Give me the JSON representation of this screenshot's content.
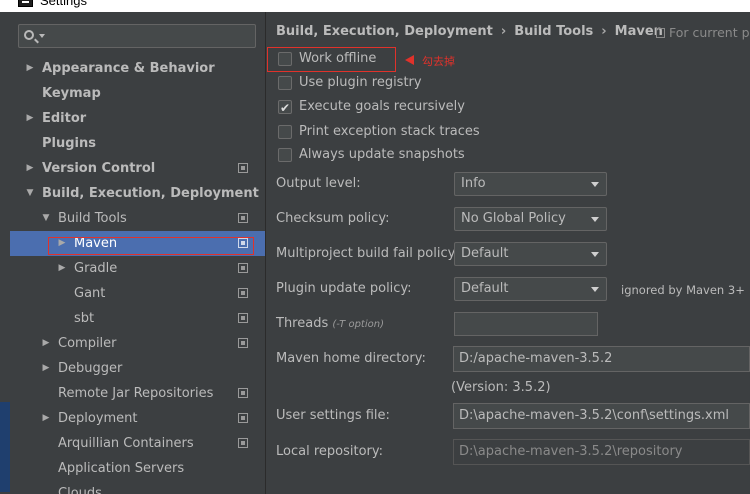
{
  "window": {
    "title": "Settings"
  },
  "search": {
    "placeholder": ""
  },
  "tree": [
    {
      "label": "Appearance & Behavior",
      "bold": true,
      "arrow": "▶",
      "level": 0,
      "icon": false
    },
    {
      "label": "Keymap",
      "bold": true,
      "arrow": "",
      "level": 0,
      "icon": false
    },
    {
      "label": "Editor",
      "bold": true,
      "arrow": "▶",
      "level": 0,
      "icon": false
    },
    {
      "label": "Plugins",
      "bold": true,
      "arrow": "",
      "level": 0,
      "icon": false
    },
    {
      "label": "Version Control",
      "bold": true,
      "arrow": "▶",
      "level": 0,
      "icon": true
    },
    {
      "label": "Build, Execution, Deployment",
      "bold": true,
      "arrow": "▼",
      "level": 0,
      "icon": false
    },
    {
      "label": "Build Tools",
      "bold": false,
      "arrow": "▼",
      "level": 1,
      "icon": true
    },
    {
      "label": "Maven",
      "bold": false,
      "arrow": "▶",
      "level": 2,
      "icon": true,
      "selected": true
    },
    {
      "label": "Gradle",
      "bold": false,
      "arrow": "▶",
      "level": 2,
      "icon": true
    },
    {
      "label": "Gant",
      "bold": false,
      "arrow": "",
      "level": 2,
      "icon": true
    },
    {
      "label": "sbt",
      "bold": false,
      "arrow": "",
      "level": 2,
      "icon": true
    },
    {
      "label": "Compiler",
      "bold": false,
      "arrow": "▶",
      "level": 1,
      "icon": true
    },
    {
      "label": "Debugger",
      "bold": false,
      "arrow": "▶",
      "level": 1,
      "icon": false
    },
    {
      "label": "Remote Jar Repositories",
      "bold": false,
      "arrow": "",
      "level": 1,
      "icon": true
    },
    {
      "label": "Deployment",
      "bold": false,
      "arrow": "▶",
      "level": 1,
      "icon": true
    },
    {
      "label": "Arquillian Containers",
      "bold": false,
      "arrow": "",
      "level": 1,
      "icon": true
    },
    {
      "label": "Application Servers",
      "bold": false,
      "arrow": "",
      "level": 1,
      "icon": false
    },
    {
      "label": "Clouds",
      "bold": false,
      "arrow": "",
      "level": 1,
      "icon": false
    }
  ],
  "breadcrumb": [
    "Build, Execution, Deployment",
    "Build Tools",
    "Maven"
  ],
  "for_project": "For current pr",
  "annotation": "勾去掉",
  "checkboxes": [
    {
      "label": "Work offline",
      "checked": false
    },
    {
      "label": "Use plugin registry",
      "checked": false
    },
    {
      "label": "Execute goals recursively",
      "checked": true
    },
    {
      "label": "Print exception stack traces",
      "checked": false
    },
    {
      "label": "Always update snapshots",
      "checked": false
    }
  ],
  "form": {
    "output_level": {
      "label": "Output level:",
      "value": "Info"
    },
    "checksum_policy": {
      "label": "Checksum policy:",
      "value": "No Global Policy"
    },
    "multiproject_policy": {
      "label": "Multiproject build fail policy:",
      "value": "Default"
    },
    "plugin_update_policy": {
      "label": "Plugin update policy:",
      "value": "Default",
      "note": "ignored by Maven 3+"
    },
    "threads": {
      "label": "Threads",
      "hint": "(-T option)",
      "value": ""
    },
    "maven_home": {
      "label": "Maven home directory:",
      "value": "D:/apache-maven-3.5.2",
      "version": "(Version: 3.5.2)"
    },
    "user_settings": {
      "label": "User settings file:",
      "value": "D:\\apache-maven-3.5.2\\conf\\settings.xml"
    },
    "local_repo": {
      "label": "Local repository:",
      "value": "D:\\apache-maven-3.5.2\\repository"
    }
  },
  "colors": {
    "selection": "#4b6eaf",
    "highlight": "#e0322b",
    "background": "#3c3f41"
  }
}
